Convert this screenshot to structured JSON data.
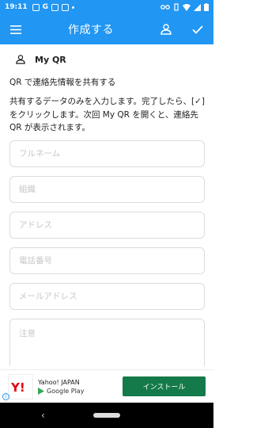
{
  "status": {
    "time": "19:11"
  },
  "appbar": {
    "title": "作成する"
  },
  "section": {
    "label": "My QR"
  },
  "desc1": "QR で連絡先情報を共有する",
  "desc2": "共有するデータのみを入力します。完了したら、[✓]をクリックします。次回 My QR を開くと、連絡先 QR が表示されます。",
  "fields": {
    "full_name": "フルネーム",
    "org": "組織",
    "address": "アドレス",
    "phone": "電話番号",
    "email": "メールアドレス",
    "memo": "注意"
  },
  "ad": {
    "brand": "Yahoo! JAPAN",
    "store": "Google Play",
    "install": "インストール"
  },
  "colors": {
    "primary": "#2196F3",
    "install_button": "#157a4a"
  }
}
